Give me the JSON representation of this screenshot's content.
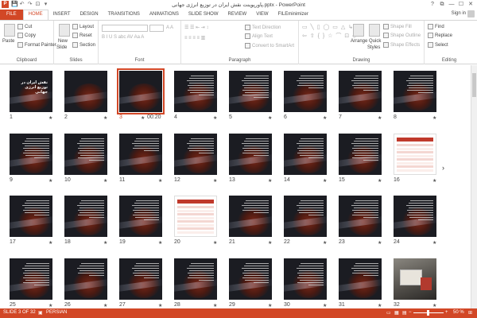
{
  "app": {
    "title": "پاورپوینت نقش ایران در توزیع انرژی جهانی.pptx - PowerPoint",
    "icon_letter": "P",
    "signin": "Sign in"
  },
  "qat": {
    "save": "💾",
    "undo": "↶",
    "redo": "↷",
    "start": "⊡",
    "more": "▾"
  },
  "window": {
    "help": "?",
    "restore": "⧉",
    "minimize": "—",
    "maximize": "☐",
    "close": "✕"
  },
  "tabs": [
    "FILE",
    "HOME",
    "INSERT",
    "DESIGN",
    "TRANSITIONS",
    "ANIMATIONS",
    "SLIDE SHOW",
    "REVIEW",
    "VIEW",
    "FILEminimizer"
  ],
  "ribbon": {
    "clipboard": {
      "label": "Clipboard",
      "paste": "Paste",
      "cut": "Cut",
      "copy": "Copy",
      "format_painter": "Format Painter"
    },
    "slides": {
      "label": "Slides",
      "new_slide": "New",
      "new_slide2": "Slide",
      "layout": "Layout",
      "reset": "Reset",
      "section": "Section"
    },
    "font": {
      "label": "Font"
    },
    "paragraph": {
      "label": "Paragraph",
      "text_direction": "Text Direction",
      "align_text": "Align Text",
      "convert": "Convert to SmartArt"
    },
    "drawing": {
      "label": "Drawing",
      "arrange": "Arrange",
      "quick_styles": "Quick",
      "quick_styles2": "Styles",
      "shape_fill": "Shape Fill",
      "shape_outline": "Shape Outline",
      "shape_effects": "Shape Effects"
    },
    "editing": {
      "label": "Editing",
      "find": "Find",
      "replace": "Replace",
      "select": "Select"
    }
  },
  "slides": [
    {
      "n": "1",
      "kind": "title",
      "heading": "نقش ایران در توزیع انرژی جهانی"
    },
    {
      "n": "2",
      "kind": "dark"
    },
    {
      "n": "3",
      "kind": "dark",
      "selected": true,
      "timing": "00:20"
    },
    {
      "n": "4",
      "kind": "text"
    },
    {
      "n": "5",
      "kind": "text"
    },
    {
      "n": "6",
      "kind": "text"
    },
    {
      "n": "7",
      "kind": "text"
    },
    {
      "n": "8",
      "kind": "text"
    },
    {
      "n": "9",
      "kind": "text"
    },
    {
      "n": "10",
      "kind": "text"
    },
    {
      "n": "11",
      "kind": "text"
    },
    {
      "n": "12",
      "kind": "text"
    },
    {
      "n": "13",
      "kind": "text"
    },
    {
      "n": "14",
      "kind": "text"
    },
    {
      "n": "15",
      "kind": "text"
    },
    {
      "n": "16",
      "kind": "table"
    },
    {
      "n": "17",
      "kind": "text"
    },
    {
      "n": "18",
      "kind": "text"
    },
    {
      "n": "19",
      "kind": "text"
    },
    {
      "n": "20",
      "kind": "table"
    },
    {
      "n": "21",
      "kind": "text"
    },
    {
      "n": "22",
      "kind": "text"
    },
    {
      "n": "23",
      "kind": "text"
    },
    {
      "n": "24",
      "kind": "text"
    },
    {
      "n": "25",
      "kind": "text"
    },
    {
      "n": "26",
      "kind": "text"
    },
    {
      "n": "27",
      "kind": "text"
    },
    {
      "n": "28",
      "kind": "text"
    },
    {
      "n": "29",
      "kind": "text"
    },
    {
      "n": "30",
      "kind": "text"
    },
    {
      "n": "31",
      "kind": "text"
    },
    {
      "n": "32",
      "kind": "photo"
    }
  ],
  "star_glyph": "★",
  "status": {
    "slide_of": "SLIDE 3 OF 32",
    "language": "PERSIAN",
    "zoom": "50 %",
    "fit": "⊞"
  },
  "colors": {
    "accent": "#d24726",
    "slide_bg": "#1b1c22"
  }
}
